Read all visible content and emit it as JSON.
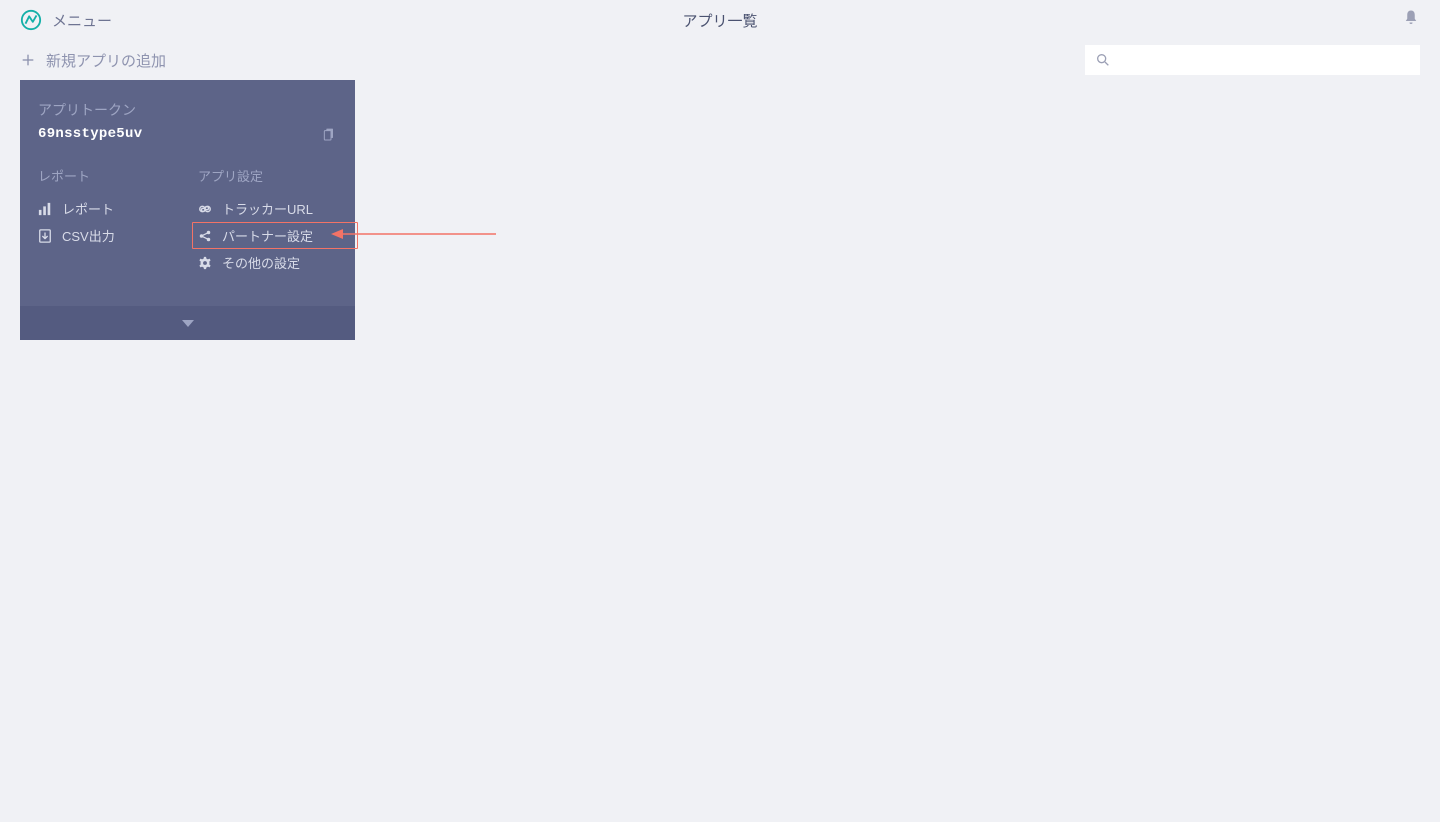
{
  "header": {
    "menu_label": "メニュー",
    "page_title": "アプリ一覧"
  },
  "subheader": {
    "add_app_label": "新規アプリの追加",
    "search_placeholder": ""
  },
  "app_card": {
    "token_label": "アプリトークン",
    "token_value": "69nsstype5uv",
    "sections": {
      "report": {
        "header": "レポート",
        "items": {
          "report": "レポート",
          "csv": "CSV出力"
        }
      },
      "settings": {
        "header": "アプリ設定",
        "items": {
          "tracker_url": "トラッカーURL",
          "partner": "パートナー設定",
          "other": "その他の設定"
        }
      }
    }
  }
}
